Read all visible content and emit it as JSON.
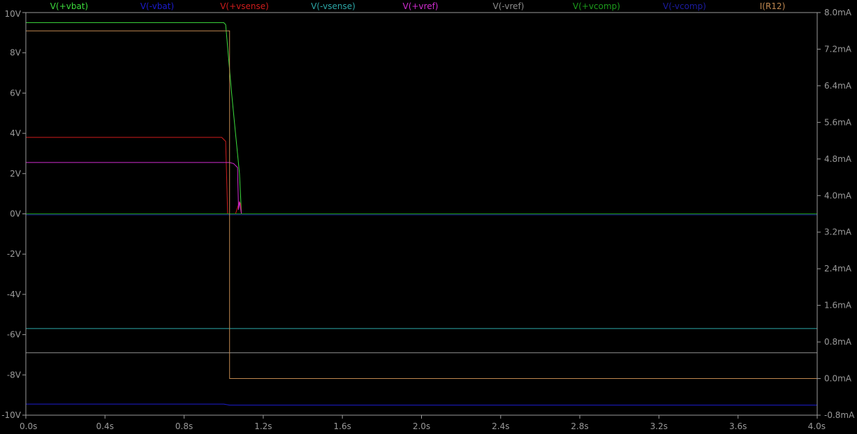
{
  "chart_data": {
    "type": "line",
    "title": "",
    "xlabel": "",
    "ylabel": "",
    "y2label": "",
    "xlim": [
      0,
      4
    ],
    "ylim": [
      -10,
      10
    ],
    "y2lim": [
      -0.8,
      8.0
    ],
    "x_ticks": [
      "0.0s",
      "0.4s",
      "0.8s",
      "1.2s",
      "1.6s",
      "2.0s",
      "2.4s",
      "2.8s",
      "3.2s",
      "3.6s",
      "4.0s"
    ],
    "x_tick_values": [
      0,
      0.4,
      0.8,
      1.2,
      1.6,
      2.0,
      2.4,
      2.8,
      3.2,
      3.6,
      4.0
    ],
    "y_ticks": [
      "10V",
      "8V",
      "6V",
      "4V",
      "2V",
      "0V",
      "-2V",
      "-4V",
      "-6V",
      "-8V",
      "-10V"
    ],
    "y_tick_values": [
      10,
      8,
      6,
      4,
      2,
      0,
      -2,
      -4,
      -6,
      -8,
      -10
    ],
    "y2_ticks": [
      "8.0mA",
      "7.2mA",
      "6.4mA",
      "5.6mA",
      "4.8mA",
      "4.0mA",
      "3.2mA",
      "2.4mA",
      "1.6mA",
      "0.8mA",
      "0.0mA",
      "-0.8mA"
    ],
    "y2_tick_values": [
      8.0,
      7.2,
      6.4,
      5.6,
      4.8,
      4.0,
      3.2,
      2.4,
      1.6,
      0.8,
      0.0,
      -0.8
    ],
    "grid": false,
    "legend_position": "top",
    "background": "#000000",
    "axis_color": "#9a9a9a",
    "series": [
      {
        "name": "V(+vbat)",
        "color": "#3cdc3c",
        "axis": "left",
        "x": [
          0,
          1.0,
          1.01,
          1.04,
          1.06,
          1.08,
          1.09,
          4.0
        ],
        "y": [
          9.5,
          9.5,
          9.4,
          6.0,
          4.0,
          2.0,
          0.0,
          0.0
        ]
      },
      {
        "name": "V(-vbat)",
        "color": "#1c1cd0",
        "axis": "left",
        "x": [
          0,
          1.0,
          1.03,
          4.0
        ],
        "y": [
          -9.45,
          -9.45,
          -9.5,
          -9.5
        ]
      },
      {
        "name": "V(+vsense)",
        "color": "#d01c1c",
        "axis": "left",
        "x": [
          0,
          0.99,
          1.01,
          1.02,
          1.06,
          1.08,
          1.085,
          1.09,
          1.1,
          4.0
        ],
        "y": [
          3.8,
          3.8,
          3.6,
          0.0,
          0.0,
          0.6,
          0.5,
          0.0,
          0.0,
          0.0
        ]
      },
      {
        "name": "V(-vsense)",
        "color": "#2ca8a8",
        "axis": "left",
        "x": [
          0,
          4.0
        ],
        "y": [
          -5.7,
          -5.7
        ]
      },
      {
        "name": "V(+vref)",
        "color": "#d02cd0",
        "axis": "left",
        "x": [
          0,
          1.0,
          1.03,
          1.05,
          1.07,
          1.075,
          1.08,
          1.09,
          4.0
        ],
        "y": [
          2.55,
          2.55,
          2.55,
          2.5,
          2.3,
          0.2,
          0.6,
          0.0,
          0.0
        ]
      },
      {
        "name": "V(-vref)",
        "color": "#8c8c8c",
        "axis": "left",
        "x": [
          0,
          4.0
        ],
        "y": [
          -6.9,
          -6.9
        ]
      },
      {
        "name": "V(+vcomp)",
        "color": "#1c9c1c",
        "axis": "left",
        "x": [
          0,
          4.0
        ],
        "y": [
          0.0,
          0.0
        ]
      },
      {
        "name": "V(-vcomp)",
        "color": "#1c1ca0",
        "axis": "left",
        "x": [
          0,
          1.1,
          4.0
        ],
        "y": [
          -0.05,
          -0.05,
          -0.05
        ]
      },
      {
        "name": "I(R12)",
        "color": "#c08850",
        "axis": "right",
        "x": [
          0,
          1.03,
          1.03,
          4.0
        ],
        "y": [
          7.6,
          7.6,
          0.0,
          0.0
        ]
      }
    ]
  }
}
